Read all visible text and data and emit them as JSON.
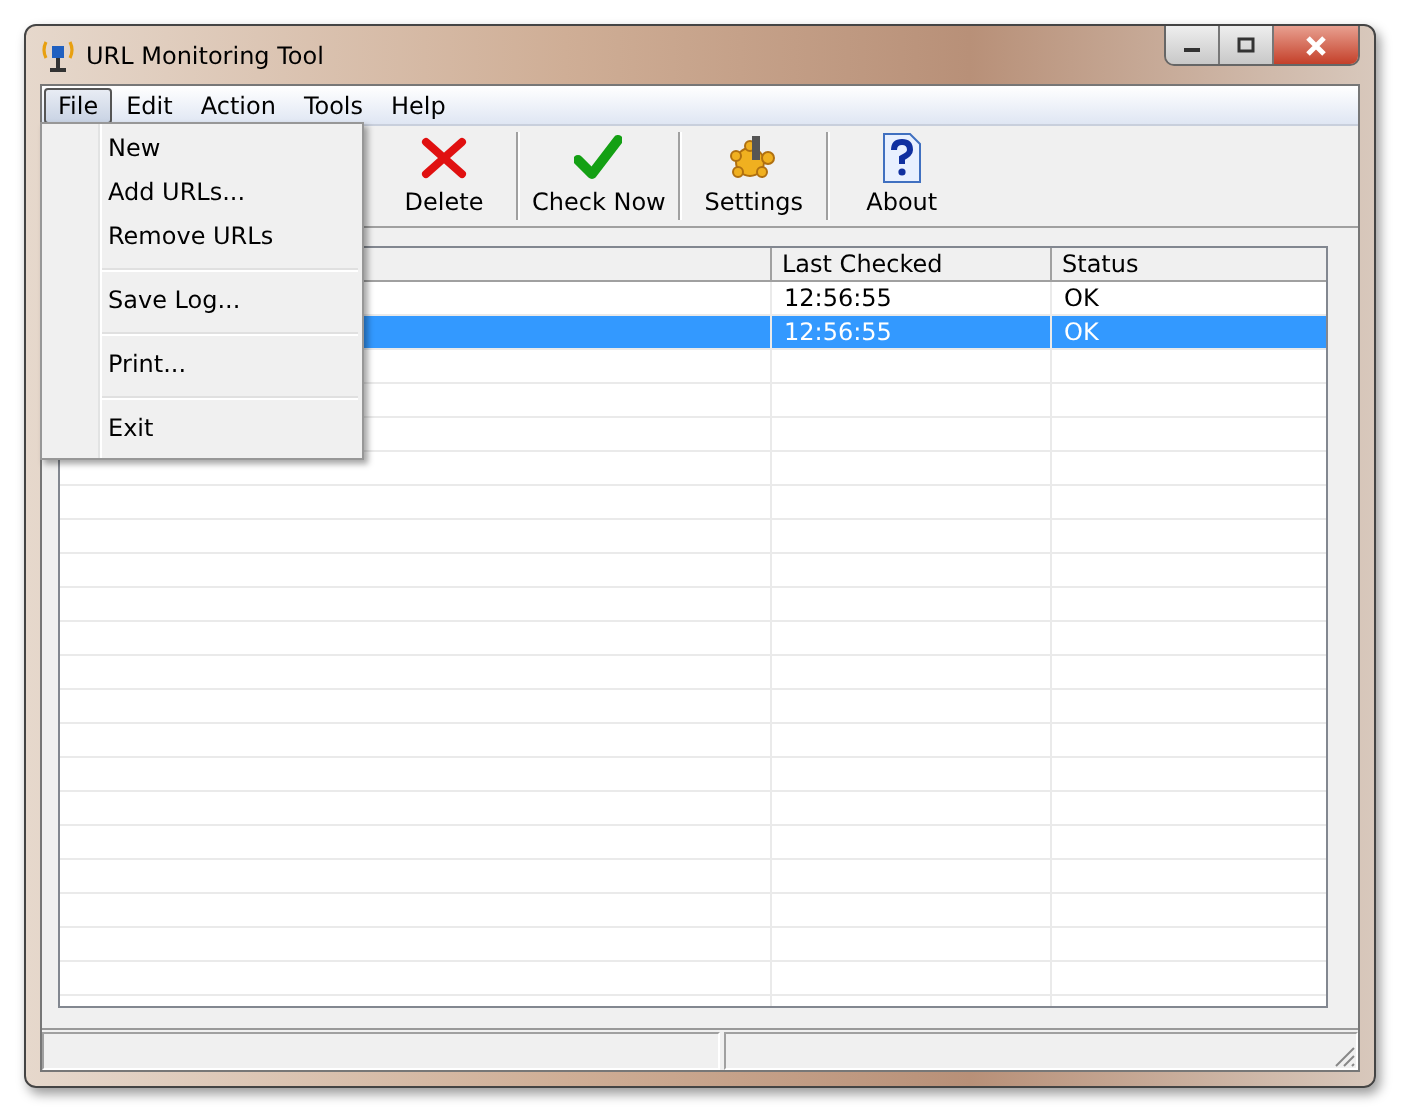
{
  "window": {
    "title": "URL Monitoring Tool"
  },
  "menubar": [
    {
      "label": "File",
      "selected": true
    },
    {
      "label": "Edit",
      "selected": false
    },
    {
      "label": "Action",
      "selected": false
    },
    {
      "label": "Tools",
      "selected": false
    },
    {
      "label": "Help",
      "selected": false
    }
  ],
  "file_menu": [
    {
      "kind": "item",
      "label": "New"
    },
    {
      "kind": "item",
      "label": "Add URLs..."
    },
    {
      "kind": "item",
      "label": "Remove URLs"
    },
    {
      "kind": "separator"
    },
    {
      "kind": "item",
      "label": "Save Log..."
    },
    {
      "kind": "separator"
    },
    {
      "kind": "item",
      "label": "Print..."
    },
    {
      "kind": "separator"
    },
    {
      "kind": "item",
      "label": "Exit"
    }
  ],
  "toolbar": [
    {
      "kind": "delete",
      "label": "Delete"
    },
    {
      "kind": "check",
      "label": "Check Now"
    },
    {
      "kind": "settings",
      "label": "Settings"
    },
    {
      "kind": "about",
      "label": "About"
    }
  ],
  "table": {
    "columns": [
      "Last Checked",
      "Status"
    ],
    "rows": [
      {
        "last_checked": "12:56:55",
        "status": "OK",
        "selected": false
      },
      {
        "last_checked": "12:56:55",
        "status": "OK",
        "selected": true
      }
    ]
  }
}
